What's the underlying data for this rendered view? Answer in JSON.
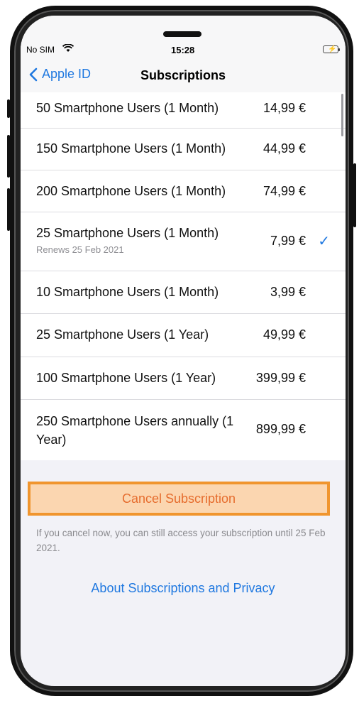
{
  "status_bar": {
    "carrier": "No SIM",
    "time": "15:28",
    "wifi_icon": "wifi-icon",
    "battery_icon": "battery-charging-icon",
    "battery_color": "#4cd964"
  },
  "nav": {
    "back_label": "Apple ID",
    "back_icon": "chevron-left-icon",
    "title": "Subscriptions"
  },
  "subscriptions": [
    {
      "name": "50 Smartphone Users (1 Month)",
      "price": "14,99 €",
      "renews": "",
      "selected": false
    },
    {
      "name": "150 Smartphone Users (1 Month)",
      "price": "44,99 €",
      "renews": "",
      "selected": false
    },
    {
      "name": "200 Smartphone Users (1 Month)",
      "price": "74,99 €",
      "renews": "",
      "selected": false
    },
    {
      "name": "25 Smartphone Users (1 Month)",
      "price": "7,99 €",
      "renews": "Renews 25 Feb 2021",
      "selected": true
    },
    {
      "name": "10 Smartphone Users (1 Month)",
      "price": "3,99 €",
      "renews": "",
      "selected": false
    },
    {
      "name": "25 Smartphone Users (1 Year)",
      "price": "49,99 €",
      "renews": "",
      "selected": false
    },
    {
      "name": "100 Smartphone Users (1 Year)",
      "price": "399,99 €",
      "renews": "",
      "selected": false
    },
    {
      "name": "250 Smartphone Users annually (1 Year)",
      "price": "899,99 €",
      "renews": "",
      "selected": false
    }
  ],
  "check_mark": "✓",
  "cancel": {
    "label": "Cancel Subscription",
    "highlight_color": "#f0952e"
  },
  "note": "If you cancel now, you can still access your subscription until 25 Feb 2021.",
  "about_link": "About Subscriptions and Privacy",
  "colors": {
    "accent": "#1f78e0",
    "destructive": "#e66d2e",
    "background": "#f2f2f7"
  }
}
